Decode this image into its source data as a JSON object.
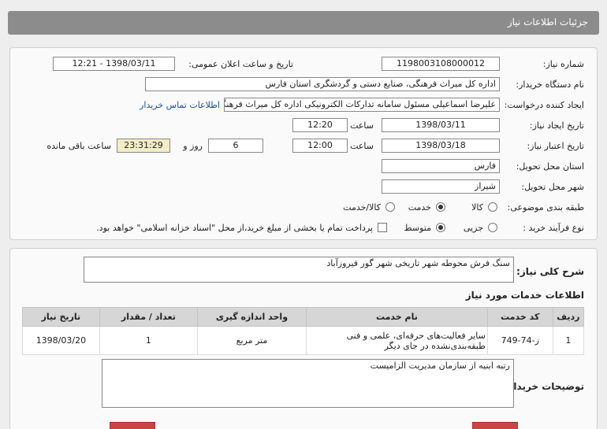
{
  "header": {
    "title": "جزئیات اطلاعات نیاز"
  },
  "form": {
    "need_number_label": "شماره نیاز:",
    "need_number": "1198003108000012",
    "announce_label": "تاریخ و ساعت اعلان عمومی:",
    "announce_value": "1398/03/11 - 12:21",
    "buyer_org_label": "نام دستگاه خریدار:",
    "buyer_org": "اداره کل میراث فرهنگی، صنایع دستی و گردشگری استان فارس",
    "requester_label": "ایجاد کننده درخواست:",
    "requester": "علیرضا اسماعیلی مسئول سامانه تدارکات الکترونیکی اداره کل میراث فرهنگی، صنایع",
    "contact_link": "اطلاعات تماس خریدار",
    "create_date_label": "تاریخ ایجاد نیاز:",
    "create_date": "1398/03/11",
    "time_label": "ساعت",
    "create_time": "12:20",
    "valid_date_label": "تاریخ اعتبار نیاز:",
    "valid_date": "1398/03/18",
    "valid_time": "12:00",
    "days_value": "6",
    "days_label": "روز و",
    "remaining_time": "23:31:29",
    "remaining_label": "ساعت باقی مانده",
    "province_label": "استان محل تحویل:",
    "province": "فارس",
    "city_label": "شهر محل تحویل:",
    "city": "شیراز",
    "category_label": "طبقه بندی موضوعی:",
    "category_options": [
      "کالا",
      "خدمت",
      "کالا/خدمت"
    ],
    "purchase_type_label": "نوع فرآیند خرید :",
    "purchase_options": [
      "جزیی",
      "متوسط"
    ],
    "payment_note": "پرداخت تمام یا بخشی از مبلغ خرید،از محل \"اسناد خزانه اسلامی\" خواهد بود."
  },
  "summary": {
    "label": "شرح کلی نیاز:",
    "value": "سنگ فرش محوطه شهر تاریخی شهر گور فیروزآباد"
  },
  "services": {
    "title": "اطلاعات خدمات مورد نیاز",
    "columns": [
      "ردیف",
      "کد خدمت",
      "نام خدمت",
      "واحد اندازه گیری",
      "تعداد / مقدار",
      "تاریخ نیاز"
    ],
    "rows": [
      [
        "1",
        "ز-74-749",
        "سایر فعالیت‌های حرفه‌ای، علمی و فنی طبقه‌بندی‌نشده در جای دیگر",
        "متر مربع",
        "1",
        "1398/03/20"
      ]
    ]
  },
  "buyer_notes": {
    "label": "توضیحات خریدار:",
    "value": "رتبه ابنیه از سازمان مدیریت الزامیست"
  }
}
